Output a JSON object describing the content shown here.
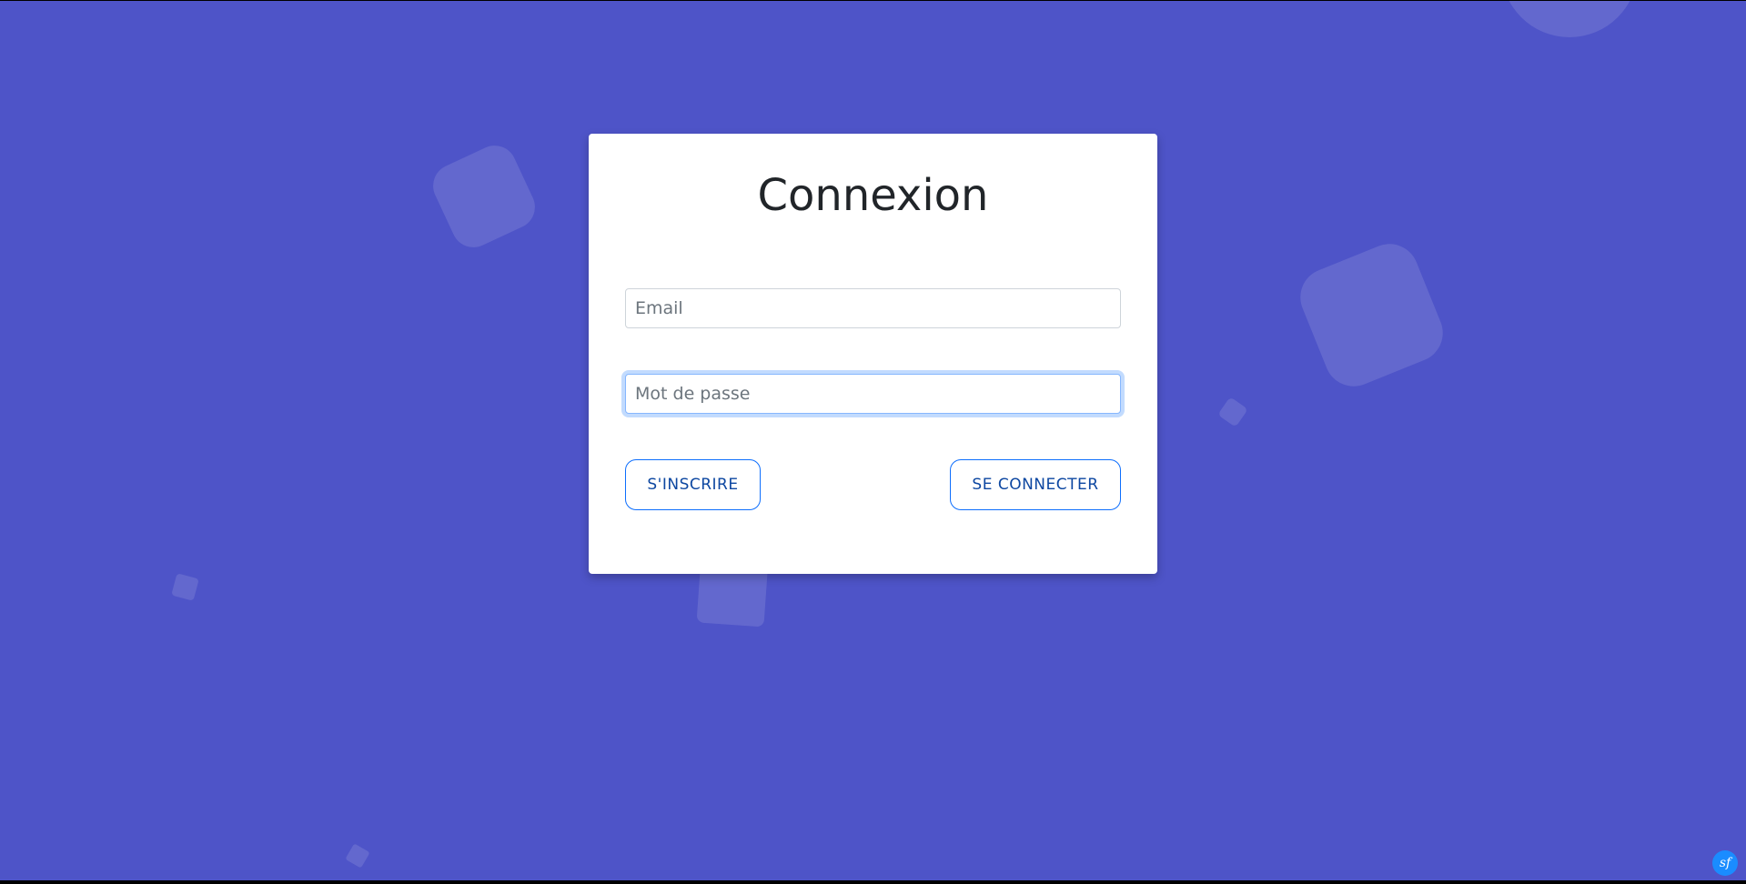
{
  "login": {
    "title": "Connexion",
    "email_placeholder": "Email",
    "password_placeholder": "Mot de passe",
    "signup_label": "S'INSCRIRE",
    "login_label": "SE CONNECTER"
  },
  "colors": {
    "background": "#4e54c8",
    "card": "#ffffff",
    "button_border": "#0d6efd",
    "button_text": "#0d47a1",
    "focus_ring": "#86b7fe"
  },
  "icons": {
    "corner_logo": "symfony-logo-icon"
  }
}
